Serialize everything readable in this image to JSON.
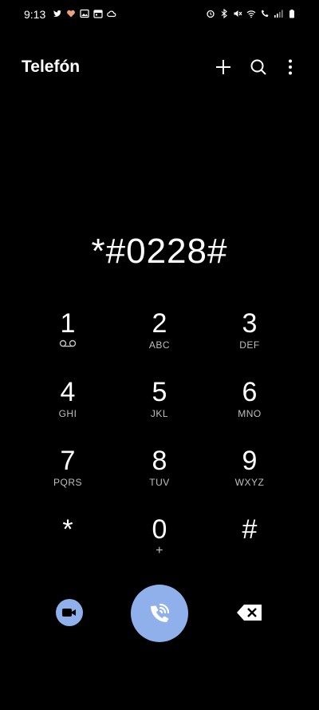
{
  "status": {
    "time": "9:13",
    "left_icons": [
      "twitter-icon",
      "heart-icon",
      "image-icon",
      "calendar-icon",
      "cloud-icon"
    ],
    "right_icons": [
      "alarm-icon",
      "bluetooth-icon",
      "mute-icon",
      "wifi-icon",
      "wifi-call-icon",
      "signal-icon",
      "battery-icon"
    ]
  },
  "appbar": {
    "title": "Telefón"
  },
  "dialer": {
    "number": "*#0228#"
  },
  "keys": [
    {
      "digit": "1",
      "letters": "",
      "sub_icon": "voicemail-icon"
    },
    {
      "digit": "2",
      "letters": "ABC"
    },
    {
      "digit": "3",
      "letters": "DEF"
    },
    {
      "digit": "4",
      "letters": "GHI"
    },
    {
      "digit": "5",
      "letters": "JKL"
    },
    {
      "digit": "6",
      "letters": "MNO"
    },
    {
      "digit": "7",
      "letters": "PQRS"
    },
    {
      "digit": "8",
      "letters": "TUV"
    },
    {
      "digit": "9",
      "letters": "WXYZ"
    },
    {
      "digit": "*",
      "letters": ""
    },
    {
      "digit": "0",
      "letters": "+"
    },
    {
      "digit": "#",
      "letters": ""
    }
  ],
  "colors": {
    "background": "#000000",
    "accent": "#8fb0ea",
    "text": "#ffffff",
    "subtext": "#bfbfbf"
  }
}
